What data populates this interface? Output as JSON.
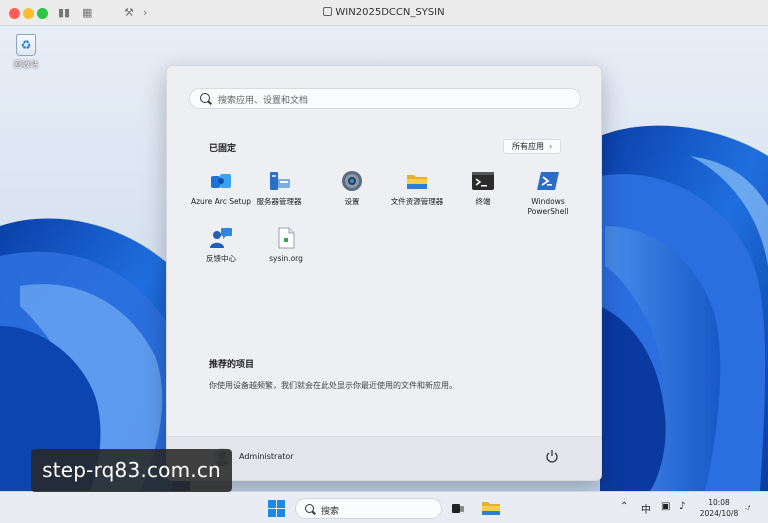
{
  "window": {
    "title": "WIN2025DCCN_SYSIN"
  },
  "desktop": {
    "recycle_bin": {
      "label": "回收站"
    }
  },
  "start_menu": {
    "search": {
      "placeholder": "搜索应用、设置和文档"
    },
    "pinned": {
      "title": "已固定",
      "all_apps_label": "所有应用",
      "apps": [
        {
          "label": "Azure Arc Setup",
          "icon": "azure-arc-icon"
        },
        {
          "label": "服务器管理器",
          "icon": "server-manager-icon"
        },
        {
          "label": "设置",
          "icon": "settings-gear-icon"
        },
        {
          "label": "文件资源管理器",
          "icon": "folder-icon"
        },
        {
          "label": "终端",
          "icon": "terminal-icon"
        },
        {
          "label": "Windows PowerShell",
          "icon": "powershell-icon"
        },
        {
          "label": "反馈中心",
          "icon": "feedback-hub-icon"
        },
        {
          "label": "sysin.org",
          "icon": "text-file-icon"
        }
      ]
    },
    "recommended": {
      "title": "推荐的项目",
      "text": "你使用设备越频繁，我们就会在此处显示你最近使用的文件和新应用。"
    },
    "footer": {
      "username": "Administrator"
    }
  },
  "watermark": {
    "text": "step-rq83.com.cn"
  },
  "taskbar": {
    "search_label": "搜索",
    "ime": "中",
    "time": "10:08",
    "date": "2024/10/8"
  },
  "colors": {
    "accent": "#1b8ae6",
    "start_bg": "#eeeff3"
  }
}
